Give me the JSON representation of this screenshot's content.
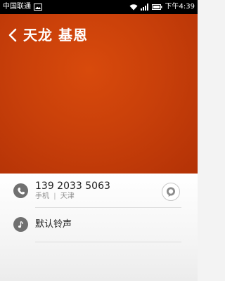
{
  "status_bar": {
    "carrier": "中国联通",
    "time": "下午4:39",
    "icons": [
      "image-icon",
      "wifi-icon",
      "signal-icon",
      "battery-icon"
    ]
  },
  "header": {
    "contact_name": "天龙 基恩",
    "background_color": "#c9400a"
  },
  "phone": {
    "number": "139 2033 5063",
    "type": "手机",
    "separator": "|",
    "location": "天津"
  },
  "ringtone": {
    "label": "默认铃声"
  }
}
